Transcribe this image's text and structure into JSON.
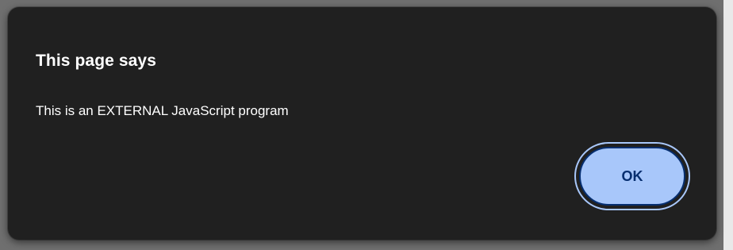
{
  "dialog": {
    "title": "This page says",
    "message": "This is an EXTERNAL JavaScript program",
    "ok_label": "OK"
  },
  "colors": {
    "dialog_background": "#202020",
    "button_fill": "#a8c7fa",
    "button_text": "#062e6f",
    "text": "#ffffff"
  }
}
